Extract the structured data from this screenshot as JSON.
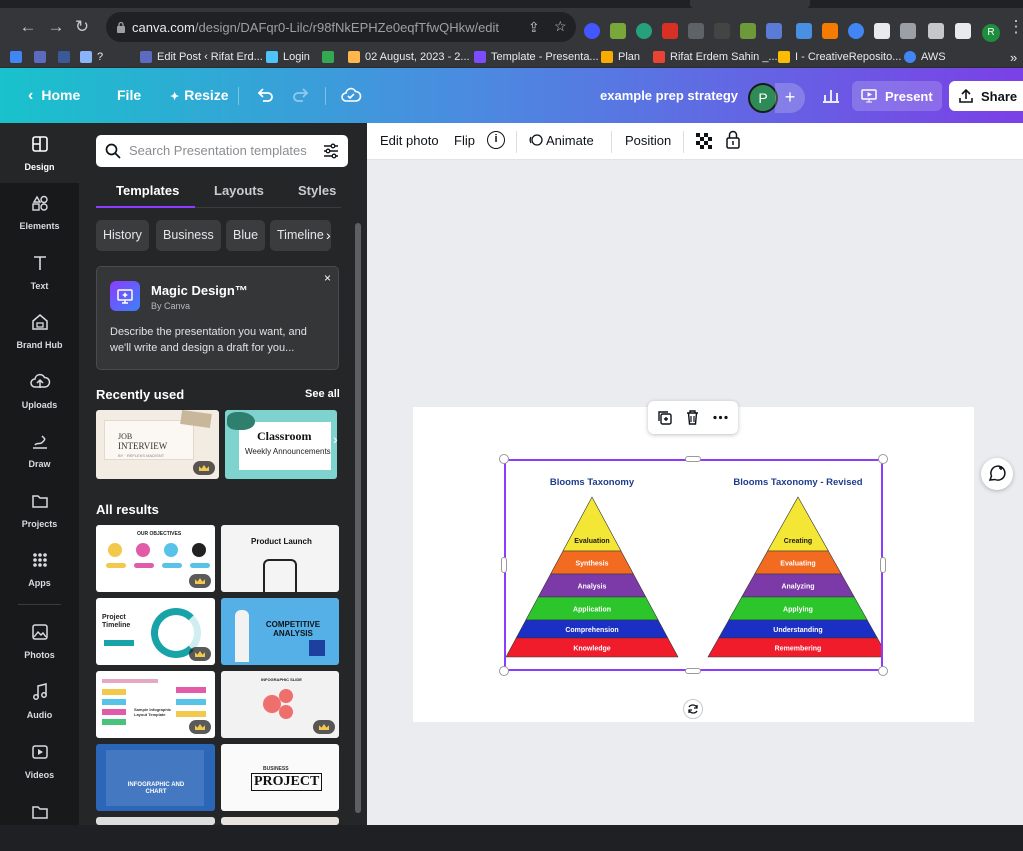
{
  "browser": {
    "url_host": "canva.com",
    "url_path": "/design/DAFqr0-Lilc/r98fNkEPHZe0eqfTfwQHkw/edit",
    "bookmarks": [
      {
        "label": "?",
        "color": "#8ab4f8"
      },
      {
        "label": "Edit Post ‹ Rifat Erd...",
        "color": "#5c6bc0"
      },
      {
        "label": "Login",
        "color": "#4fc3f7"
      },
      {
        "label": "",
        "color": "#34a853"
      },
      {
        "label": "02 August, 2023 - 2...",
        "color": "#ffb74d"
      },
      {
        "label": "Template - Presenta...",
        "color": "#7c4dff"
      },
      {
        "label": "Plan",
        "color": "#f9ab00"
      },
      {
        "label": "Rifat Erdem Sahin _...",
        "color": "#ea4335"
      },
      {
        "label": "I - CreativeReposito...",
        "color": "#fbbc04"
      },
      {
        "label": "AWS",
        "color": "#4285f4"
      }
    ],
    "overflow": "»"
  },
  "header": {
    "home": "Home",
    "file": "File",
    "resize": "Resize",
    "design_title": "example prep strategy",
    "avatar_letter": "P",
    "add": "+",
    "present": "Present",
    "share": "Share"
  },
  "rail": [
    {
      "label": "Design",
      "icon": "design-icon"
    },
    {
      "label": "Elements",
      "icon": "elements-icon"
    },
    {
      "label": "Text",
      "icon": "text-icon"
    },
    {
      "label": "Brand Hub",
      "icon": "brand-hub-icon"
    },
    {
      "label": "Uploads",
      "icon": "uploads-icon"
    },
    {
      "label": "Draw",
      "icon": "draw-icon"
    },
    {
      "label": "Projects",
      "icon": "projects-icon"
    },
    {
      "label": "Apps",
      "icon": "apps-icon"
    },
    {
      "label": "Photos",
      "icon": "photos-icon"
    },
    {
      "label": "Audio",
      "icon": "audio-icon"
    },
    {
      "label": "Videos",
      "icon": "videos-icon"
    }
  ],
  "panel": {
    "search_placeholder": "Search Presentation templates",
    "tabs": [
      "Templates",
      "Layouts",
      "Styles"
    ],
    "chips": [
      "History",
      "Business",
      "Blue",
      "Timeline"
    ],
    "magic": {
      "title": "Magic Design™",
      "subtitle": "By Canva",
      "description": "Describe the presentation you want, and we'll write and design a draft for you...",
      "close": "×"
    },
    "recently_used": "Recently used",
    "see_all": "See all",
    "recent": [
      {
        "line1": "JOB",
        "line2": "INTERVIEW",
        "line3": "BY · REFLEKS MADISNT"
      },
      {
        "line1": "Classroom",
        "line2": "Weekly Announcements"
      }
    ],
    "all_results": "All results",
    "results": [
      {
        "title": "OUR OBJECTIVES"
      },
      {
        "title": "Product Launch"
      },
      {
        "title": "Project Timeline"
      },
      {
        "title": "COMPETITIVE ANALYSIS"
      },
      {
        "title": "Sample Infographic Layout Template"
      },
      {
        "title": "INFOGRAPHIC SLIDE"
      },
      {
        "title": "INFOGRAPHIC AND CHART"
      },
      {
        "title": "BUSINESS",
        "subtitle": "PROJECT"
      }
    ]
  },
  "toolbar": {
    "edit_photo": "Edit photo",
    "flip": "Flip",
    "info": "i",
    "animate": "Animate",
    "position": "Position"
  },
  "canvas": {
    "left_title": "Blooms Taxonomy",
    "right_title": "Blooms Taxonomy - Revised",
    "left_levels": [
      "Evaluation",
      "Synthesis",
      "Analysis",
      "Application",
      "Comprehension",
      "Knowledge"
    ],
    "right_levels": [
      "Creating",
      "Evaluating",
      "Analyzing",
      "Applying",
      "Understanding",
      "Remembering"
    ],
    "level_colors": [
      "#f4e634",
      "#f26b21",
      "#7b3aa8",
      "#2cc52c",
      "#1c2fc4",
      "#f01c2c"
    ]
  }
}
